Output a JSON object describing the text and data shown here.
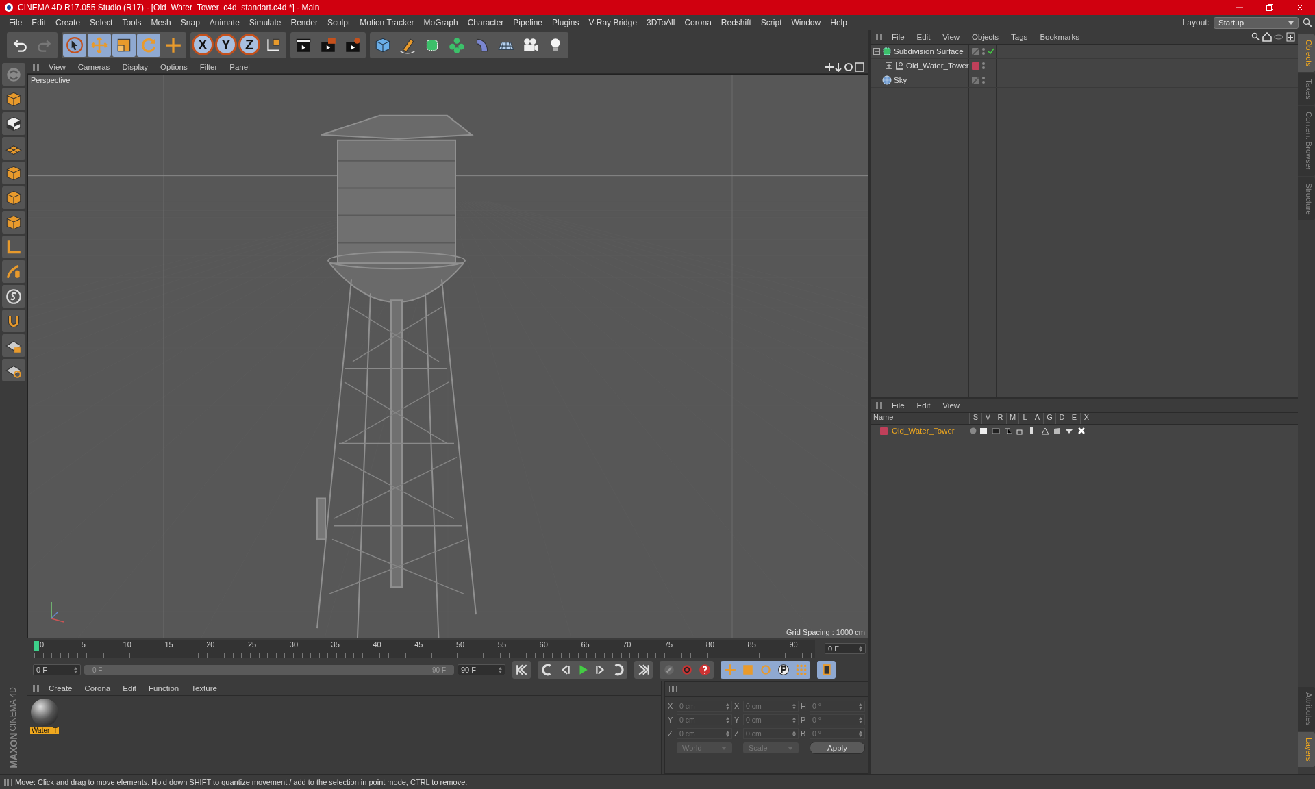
{
  "window": {
    "title": "CINEMA 4D R17.055 Studio (R17) - [Old_Water_Tower_c4d_standart.c4d *] - Main"
  },
  "menu": [
    "File",
    "Edit",
    "Create",
    "Select",
    "Tools",
    "Mesh",
    "Snap",
    "Animate",
    "Simulate",
    "Render",
    "Sculpt",
    "Motion Tracker",
    "MoGraph",
    "Character",
    "Pipeline",
    "Plugins",
    "V-Ray Bridge",
    "3DToAll",
    "Corona",
    "Redshift",
    "Script",
    "Window",
    "Help"
  ],
  "layout": {
    "label": "Layout:",
    "value": "Startup"
  },
  "toolbar": {
    "axis_buttons": [
      "X",
      "Y",
      "Z"
    ]
  },
  "viewport": {
    "menu": [
      "View",
      "Cameras",
      "Display",
      "Options",
      "Filter",
      "Panel"
    ],
    "camera": "Perspective",
    "grid_spacing": "Grid Spacing : 1000 cm"
  },
  "timeline": {
    "ticks": [
      "0",
      "5",
      "10",
      "15",
      "20",
      "25",
      "30",
      "35",
      "40",
      "45",
      "50",
      "55",
      "60",
      "65",
      "70",
      "75",
      "80",
      "85",
      "90"
    ],
    "current_frame": "0 F",
    "start_field": "0 F",
    "range_start": "0 F",
    "range_end": "90 F",
    "end_field": "90 F"
  },
  "material_manager": {
    "menu": [
      "Create",
      "Corona",
      "Edit",
      "Function",
      "Texture"
    ],
    "materials": [
      {
        "name": "Water_T",
        "selected": true
      }
    ]
  },
  "coordinates": {
    "headers": [
      "--",
      "--",
      "--"
    ],
    "rows": [
      {
        "label_1": "X",
        "value_1": "0 cm",
        "label_2": "X",
        "value_2": "0 cm",
        "label_3": "H",
        "value_3": "0 °"
      },
      {
        "label_1": "Y",
        "value_1": "0 cm",
        "label_2": "Y",
        "value_2": "0 cm",
        "label_3": "P",
        "value_3": "0 °"
      },
      {
        "label_1": "Z",
        "value_1": "0 cm",
        "label_2": "Z",
        "value_2": "0 cm",
        "label_3": "B",
        "value_3": "0 °"
      }
    ],
    "dropdowns": [
      "World",
      "Scale"
    ],
    "apply": "Apply"
  },
  "object_manager": {
    "menu": [
      "File",
      "Edit",
      "View",
      "Objects",
      "Tags",
      "Bookmarks"
    ],
    "items": [
      {
        "name": "Subdivision Surface",
        "kind": "subdivision",
        "expanded": true,
        "enabled": true,
        "children": [
          {
            "name": "Old_Water_Tower",
            "kind": "null",
            "expanded": false,
            "color": "#c0405a"
          }
        ]
      },
      {
        "name": "Sky",
        "kind": "sky"
      }
    ]
  },
  "layer_manager": {
    "menu": [
      "File",
      "Edit",
      "View"
    ],
    "columns": [
      "Name",
      "S",
      "V",
      "R",
      "M",
      "L",
      "A",
      "G",
      "D",
      "E",
      "X"
    ],
    "layers": [
      {
        "name": "Old_Water_Tower",
        "color": "#c0405a"
      }
    ]
  },
  "side_tabs": {
    "top": [
      {
        "label": "Objects",
        "selected": true
      },
      {
        "label": "Takes",
        "selected": false
      },
      {
        "label": "Content Browser",
        "selected": false
      },
      {
        "label": "Structure",
        "selected": false
      }
    ],
    "bottom": [
      {
        "label": "Attributes",
        "selected": false
      },
      {
        "label": "Layers",
        "selected": true
      }
    ]
  },
  "logo": {
    "brand": "MAXON",
    "product": "CINEMA 4D"
  },
  "status_bar": "Move: Click and drag to move elements. Hold down SHIFT to quantize movement / add to the selection in point mode, CTRL to remove."
}
